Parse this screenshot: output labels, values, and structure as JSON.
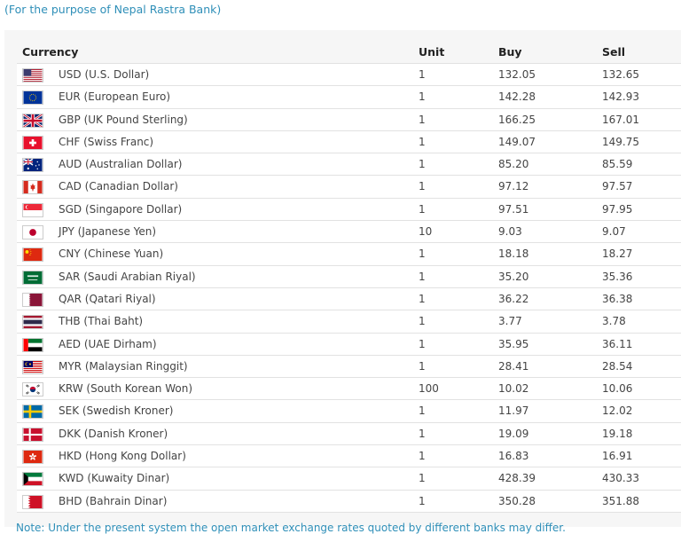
{
  "subtitle": "(For the purpose of Nepal Rastra Bank)",
  "table": {
    "headers": {
      "currency": "Currency",
      "unit": "Unit",
      "buy": "Buy",
      "sell": "Sell"
    },
    "rows": [
      {
        "flag": "us-flag-icon",
        "currency": "USD (U.S. Dollar)",
        "unit": "1",
        "buy": "132.05",
        "sell": "132.65"
      },
      {
        "flag": "eu-flag-icon",
        "currency": "EUR (European Euro)",
        "unit": "1",
        "buy": "142.28",
        "sell": "142.93"
      },
      {
        "flag": "gb-flag-icon",
        "currency": "GBP (UK Pound Sterling)",
        "unit": "1",
        "buy": "166.25",
        "sell": "167.01"
      },
      {
        "flag": "ch-flag-icon",
        "currency": "CHF (Swiss Franc)",
        "unit": "1",
        "buy": "149.07",
        "sell": "149.75"
      },
      {
        "flag": "au-flag-icon",
        "currency": "AUD (Australian Dollar)",
        "unit": "1",
        "buy": "85.20",
        "sell": "85.59"
      },
      {
        "flag": "ca-flag-icon",
        "currency": "CAD (Canadian Dollar)",
        "unit": "1",
        "buy": "97.12",
        "sell": "97.57"
      },
      {
        "flag": "sg-flag-icon",
        "currency": "SGD (Singapore Dollar)",
        "unit": "1",
        "buy": "97.51",
        "sell": "97.95"
      },
      {
        "flag": "jp-flag-icon",
        "currency": "JPY (Japanese Yen)",
        "unit": "10",
        "buy": "9.03",
        "sell": "9.07"
      },
      {
        "flag": "cn-flag-icon",
        "currency": "CNY (Chinese Yuan)",
        "unit": "1",
        "buy": "18.18",
        "sell": "18.27"
      },
      {
        "flag": "sa-flag-icon",
        "currency": "SAR (Saudi Arabian Riyal)",
        "unit": "1",
        "buy": "35.20",
        "sell": "35.36"
      },
      {
        "flag": "qa-flag-icon",
        "currency": "QAR (Qatari Riyal)",
        "unit": "1",
        "buy": "36.22",
        "sell": "36.38"
      },
      {
        "flag": "th-flag-icon",
        "currency": "THB (Thai Baht)",
        "unit": "1",
        "buy": "3.77",
        "sell": "3.78"
      },
      {
        "flag": "ae-flag-icon",
        "currency": "AED (UAE Dirham)",
        "unit": "1",
        "buy": "35.95",
        "sell": "36.11"
      },
      {
        "flag": "my-flag-icon",
        "currency": "MYR (Malaysian Ringgit)",
        "unit": "1",
        "buy": "28.41",
        "sell": "28.54"
      },
      {
        "flag": "kr-flag-icon",
        "currency": "KRW (South Korean Won)",
        "unit": "100",
        "buy": "10.02",
        "sell": "10.06"
      },
      {
        "flag": "se-flag-icon",
        "currency": "SEK (Swedish Kroner)",
        "unit": "1",
        "buy": "11.97",
        "sell": "12.02"
      },
      {
        "flag": "dk-flag-icon",
        "currency": "DKK (Danish Kroner)",
        "unit": "1",
        "buy": "19.09",
        "sell": "19.18"
      },
      {
        "flag": "hk-flag-icon",
        "currency": "HKD (Hong Kong Dollar)",
        "unit": "1",
        "buy": "16.83",
        "sell": "16.91"
      },
      {
        "flag": "kw-flag-icon",
        "currency": "KWD (Kuwaity Dinar)",
        "unit": "1",
        "buy": "428.39",
        "sell": "430.33"
      },
      {
        "flag": "bh-flag-icon",
        "currency": "BHD (Bahrain Dinar)",
        "unit": "1",
        "buy": "350.28",
        "sell": "351.88"
      }
    ]
  },
  "note": "Note: Under the present system the open market exchange rates quoted by different banks may differ.",
  "colors": {
    "link": "#2f8fb8",
    "panel": "#f6f6f6",
    "row_border": "#e2e2e2"
  }
}
